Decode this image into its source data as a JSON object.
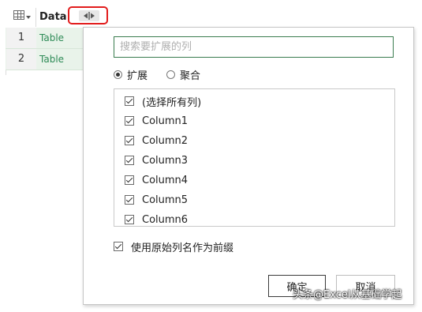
{
  "grid": {
    "column_header": "Data",
    "rows": [
      {
        "index": "1",
        "value": "Table"
      },
      {
        "index": "2",
        "value": "Table"
      }
    ],
    "cell_color": "#2e8b57",
    "highlight_color": "#e21c1c"
  },
  "popup": {
    "search_placeholder": "搜索要扩展的列",
    "modes": [
      {
        "label": "扩展",
        "selected": true
      },
      {
        "label": "聚合",
        "selected": false
      }
    ],
    "columns": [
      {
        "label": "(选择所有列)",
        "checked": true
      },
      {
        "label": "Column1",
        "checked": true
      },
      {
        "label": "Column2",
        "checked": true
      },
      {
        "label": "Column3",
        "checked": true
      },
      {
        "label": "Column4",
        "checked": true
      },
      {
        "label": "Column5",
        "checked": true
      },
      {
        "label": "Column6",
        "checked": true
      }
    ],
    "use_prefix": {
      "label": "使用原始列名作为前缀",
      "checked": true
    },
    "ok_label": "确定",
    "cancel_label": "取消",
    "accent_color": "#3a7c4f"
  },
  "watermark": "头条@Excel从基础学起"
}
